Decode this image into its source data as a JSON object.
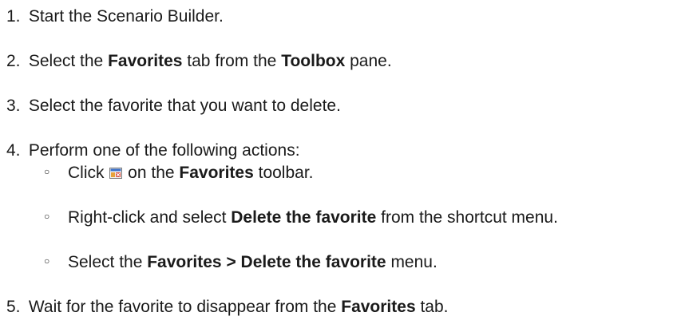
{
  "steps": [
    {
      "number": "1.",
      "parts": [
        {
          "text": "Start the Scenario Builder.",
          "bold": false
        }
      ]
    },
    {
      "number": "2.",
      "parts": [
        {
          "text": "Select the ",
          "bold": false
        },
        {
          "text": "Favorites",
          "bold": true
        },
        {
          "text": " tab from the ",
          "bold": false
        },
        {
          "text": "Toolbox",
          "bold": true
        },
        {
          "text": " pane.",
          "bold": false
        }
      ]
    },
    {
      "number": "3.",
      "parts": [
        {
          "text": "Select the favorite that you want to delete.",
          "bold": false
        }
      ]
    },
    {
      "number": "4.",
      "parts": [
        {
          "text": "Perform one of the following actions:",
          "bold": false
        }
      ],
      "substeps": [
        {
          "bullet": "○",
          "parts": [
            {
              "text": "Click ",
              "bold": false
            },
            {
              "icon": "delete-favorite-icon"
            },
            {
              "text": " on the ",
              "bold": false
            },
            {
              "text": "Favorites",
              "bold": true
            },
            {
              "text": " toolbar.",
              "bold": false
            }
          ]
        },
        {
          "bullet": "○",
          "parts": [
            {
              "text": "Right-click and select ",
              "bold": false
            },
            {
              "text": "Delete the favorite",
              "bold": true
            },
            {
              "text": " from the shortcut menu.",
              "bold": false
            }
          ]
        },
        {
          "bullet": "○",
          "parts": [
            {
              "text": "Select the ",
              "bold": false
            },
            {
              "text": "Favorites > Delete the favorite",
              "bold": true
            },
            {
              "text": " menu.",
              "bold": false
            }
          ]
        }
      ]
    },
    {
      "number": "5.",
      "parts": [
        {
          "text": "Wait for the favorite to disappear from the ",
          "bold": false
        },
        {
          "text": "Favorites",
          "bold": true
        },
        {
          "text": " tab.",
          "bold": false
        }
      ]
    }
  ]
}
